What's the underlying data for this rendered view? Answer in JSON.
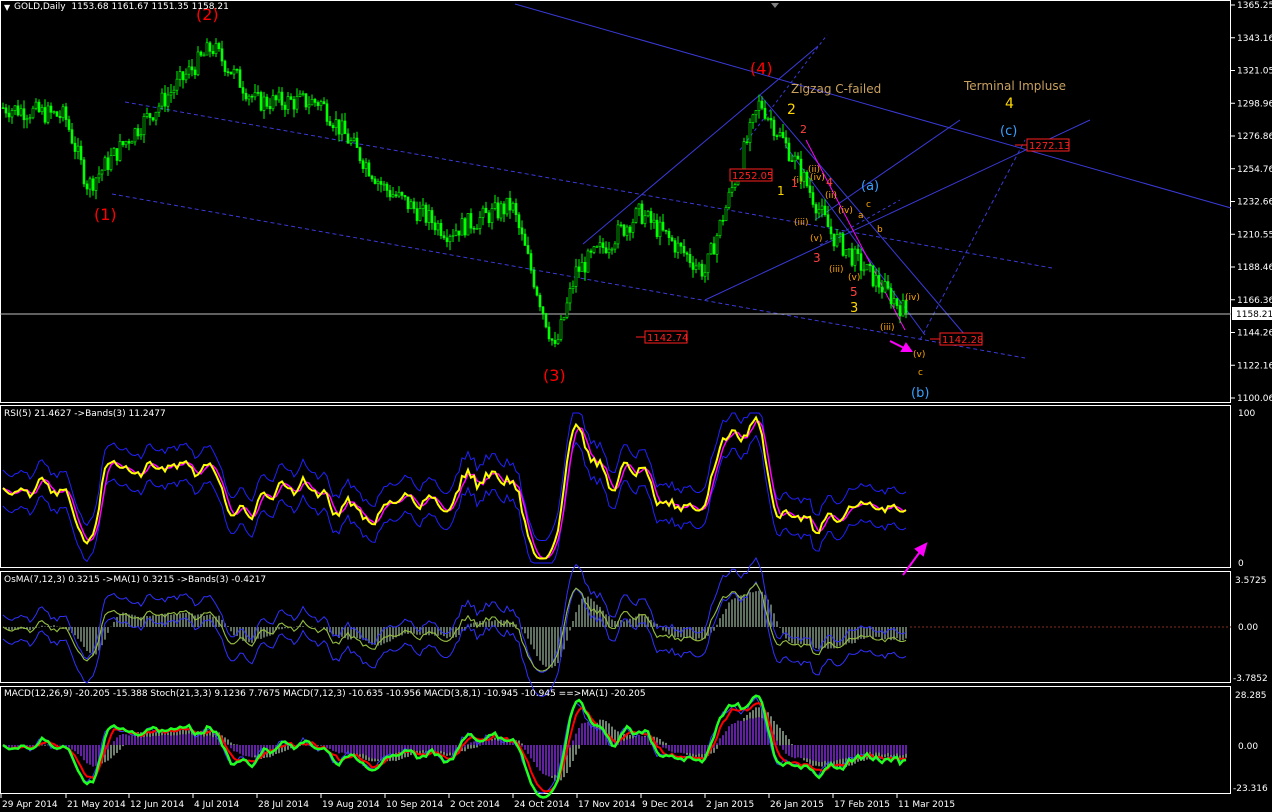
{
  "colors": {
    "background": "#000000",
    "grid_frame": "#ffffff",
    "up_candle": "#00ff00",
    "down_candle": "#00ff00",
    "channel": "#3a3ad8",
    "wave_primary": "#ff0000",
    "wave_minor": "#ffa500",
    "wave_blue": "#3aa0ff",
    "rsi_line": "#ffff00",
    "rsi_ma": "#ff00ff",
    "bands": "#2020ff",
    "arrow": "#ff00ff",
    "price_label": "#ff2020"
  },
  "main": {
    "title": "GOLD,Daily",
    "ohlc": "1153.68 1161.67 1151.35 1158.21",
    "current_price": "1158.21",
    "y_ticks": [
      "1365.25",
      "1343.16",
      "1321.05",
      "1298.96",
      "1276.86",
      "1254.76",
      "1232.66",
      "1210.55",
      "1188.46",
      "1166.36",
      "1144.26",
      "1122.16",
      "1100.06"
    ],
    "x_ticks": [
      "29 Apr 2014",
      "21 May 2014",
      "12 Jun 2014",
      "4 Jul 2014",
      "28 Jul 2014",
      "19 Aug 2014",
      "10 Sep 2014",
      "2 Oct 2014",
      "24 Oct 2014",
      "17 Nov 2014",
      "9 Dec 2014",
      "2 Jan 2015",
      "26 Jan 2015",
      "17 Feb 2015",
      "11 Mar 2015"
    ],
    "annotations": {
      "w1": "(1)",
      "w2": "(2)",
      "w3": "(3)",
      "w4": "(4)",
      "zigzag": "Zigzag C-failed",
      "terminal": "Terminal Impluse",
      "terminal4": "4",
      "c_blue": "(c)",
      "a_blue": "(a)",
      "b_blue": "(b)",
      "lbl_1252": "1252.05",
      "lbl_1272": "1272.13",
      "lbl_1142_74": "1142.74",
      "lbl_1142_28": "1142.28",
      "minor": [
        "2",
        "(ii)",
        "1",
        "(iii)",
        "(iv)",
        "(i)",
        "(v)",
        "(iii)",
        "(iv)",
        "(v)",
        "(ii)",
        "(iv)",
        "(iii)",
        "(v)",
        "a",
        "b",
        "c",
        "3",
        "4",
        "5",
        "1",
        "2",
        "3",
        "c"
      ]
    }
  },
  "rsi": {
    "title": "RSI(5) 21.4627  ->Bands(3) 11.2477",
    "ticks": [
      "100",
      "0"
    ]
  },
  "osma": {
    "title": "OsMA(7,12,3) 0.3215  ->MA(1) 0.3215  ->Bands(3) -0.4217",
    "ticks": [
      "3.5725",
      "0.00",
      "-3.7852"
    ]
  },
  "macd": {
    "title": "MACD(12,26,9) -20.205 -15.388  Stoch(21,3,3) 9.1236 7.7675  MACD(7,12,3) -10.635 -10.956  MACD(3,8,1) -10.945 -10.945  ==>MA(1) -20.205",
    "ticks": [
      "28.285",
      "0.00",
      "-23.316"
    ]
  },
  "chart_data": {
    "type": "candlestick",
    "symbol": "GOLD",
    "timeframe": "Daily",
    "ylim": [
      1100.06,
      1365.25
    ],
    "anchor_closes": [
      {
        "date": "29 Apr 2014",
        "close": 1296
      },
      {
        "date": "21 May 2014",
        "close": 1290
      },
      {
        "date": "3 Jun 2014",
        "close": 1243
      },
      {
        "date": "12 Jun 2014",
        "close": 1275
      },
      {
        "date": "10 Jul 2014",
        "close": 1337
      },
      {
        "date": "28 Jul 2014",
        "close": 1300
      },
      {
        "date": "19 Aug 2014",
        "close": 1300
      },
      {
        "date": "10 Sep 2014",
        "close": 1242
      },
      {
        "date": "2 Oct 2014",
        "close": 1212
      },
      {
        "date": "24 Oct 2014",
        "close": 1230
      },
      {
        "date": "7 Nov 2014",
        "close": 1132
      },
      {
        "date": "17 Nov 2014",
        "close": 1185
      },
      {
        "date": "9 Dec 2014",
        "close": 1225
      },
      {
        "date": "30 Dec 2014",
        "close": 1185
      },
      {
        "date": "22 Jan 2015",
        "close": 1300
      },
      {
        "date": "5 Feb 2015",
        "close": 1260
      },
      {
        "date": "17 Feb 2015",
        "close": 1210
      },
      {
        "date": "11 Mar 2015",
        "close": 1158
      }
    ]
  }
}
